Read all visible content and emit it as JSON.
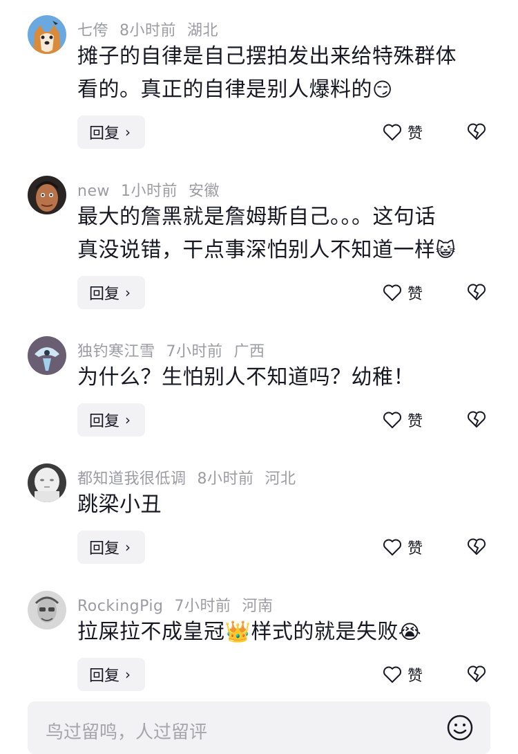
{
  "comments": [
    {
      "author": "七侉",
      "time": "8小时前",
      "location": "湖北",
      "lines": [
        "摊子的自律是自己摆拍发出来给特殊群体",
        "看的。真正的自律是别人爆料的"
      ],
      "emoji": "😏",
      "reply_label": "回复",
      "like_label": "赞",
      "avatar": "shiba-dog"
    },
    {
      "author": "new",
      "time": "1小时前",
      "location": "安徽",
      "lines": [
        "最大的詹黑就是詹姆斯自己。。。这句话",
        "真没说错，干点事深怕别人不知道一样"
      ],
      "emoji": "😺",
      "reply_label": "回复",
      "like_label": "赞",
      "avatar": "man-face"
    },
    {
      "author": "独钓寒江雪",
      "time": "7小时前",
      "location": "广西",
      "lines": [
        "为什么？生怕别人不知道吗？幼稚！"
      ],
      "emoji": "",
      "reply_label": "回复",
      "like_label": "赞",
      "avatar": "blue-creature"
    },
    {
      "author": "都知道我很低调",
      "time": "8小时前",
      "location": "河北",
      "lines": [
        "跳梁小丑"
      ],
      "emoji": "",
      "reply_label": "回复",
      "like_label": "赞",
      "avatar": "white-face"
    },
    {
      "author": "RockingPig",
      "time": "7小时前",
      "location": "河南",
      "lines": [
        "拉屎拉不成皇冠👑样式的就是失败"
      ],
      "emoji": "😭",
      "reply_label": "回复",
      "like_label": "赞",
      "avatar": "sketch-man"
    }
  ],
  "footer": {
    "placeholder": "鸟过留鸣，人过留评",
    "icon": "smile-icon"
  },
  "colors": {
    "meta": "#9a9ca3",
    "text": "#161823",
    "reply_bg": "#f2f2f4"
  }
}
